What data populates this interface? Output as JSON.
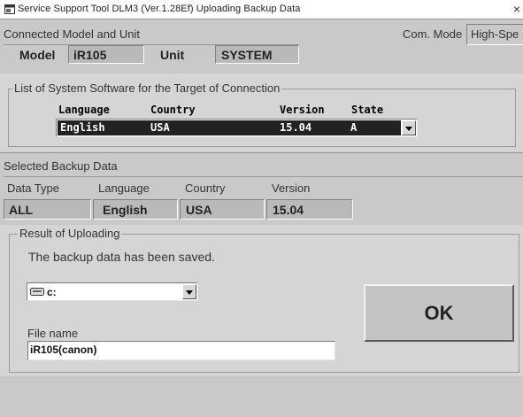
{
  "window": {
    "title": "Service Support Tool DLM3 (Ver.1.28Ef) Uploading Backup Data",
    "close_glyph": "×"
  },
  "connected": {
    "header": "Connected Model and Unit",
    "com_mode_label": "Com. Mode",
    "com_mode_value": "High-Spe",
    "model_label": "Model",
    "model_value": "iR105",
    "unit_label": "Unit",
    "unit_value": "SYSTEM"
  },
  "software_list": {
    "legend": "List of System Software for the Target of Connection",
    "columns": {
      "language": "Language",
      "country": "Country",
      "version": "Version",
      "state": "State"
    },
    "selected_row": {
      "language": "English",
      "country": "USA",
      "version": "15.04",
      "state": "A"
    }
  },
  "selected_backup": {
    "header": "Selected Backup Data",
    "columns": [
      "Data Type",
      "Language",
      "Country",
      "Version"
    ],
    "values": [
      "ALL",
      "English",
      "USA",
      "15.04"
    ]
  },
  "result": {
    "legend": "Result of Uploading",
    "message": "The backup data has been saved.",
    "drive_value": "c:",
    "file_name_label": "File name",
    "file_name_value": "iR105(canon)",
    "ok_label": "OK"
  },
  "icons": {
    "app": "app-window-icon",
    "drive": "hard-drive-icon",
    "dropdown": "dropdown-arrow-icon"
  },
  "colors": {
    "window_bg": "#c9c9c9",
    "selection_bg": "#222222",
    "selection_text": "#ffffff",
    "field_bg": "#ffffff"
  }
}
